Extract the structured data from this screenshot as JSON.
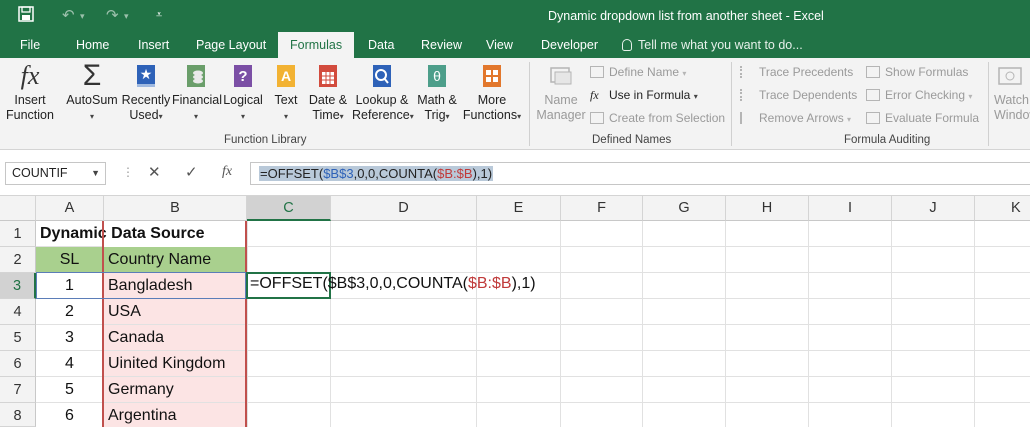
{
  "window": {
    "title": "Dynamic dropdown list from another sheet  -  Excel"
  },
  "tabs": [
    {
      "label": "File"
    },
    {
      "label": "Home"
    },
    {
      "label": "Insert"
    },
    {
      "label": "Page Layout"
    },
    {
      "label": "Formulas"
    },
    {
      "label": "Data"
    },
    {
      "label": "Review"
    },
    {
      "label": "View"
    },
    {
      "label": "Developer"
    }
  ],
  "tell_me": "Tell me what you want to do...",
  "ribbon": {
    "function_library": {
      "label": "Function Library",
      "insert_function": [
        "Insert",
        "Function"
      ],
      "autosum": "AutoSum",
      "recently_used": [
        "Recently",
        "Used"
      ],
      "financial": "Financial",
      "logical": "Logical",
      "text": "Text",
      "date_time": [
        "Date &",
        "Time"
      ],
      "lookup_reference": [
        "Lookup &",
        "Reference"
      ],
      "math_trig": [
        "Math &",
        "Trig"
      ],
      "more_functions": [
        "More",
        "Functions"
      ]
    },
    "defined_names": {
      "label": "Defined Names",
      "name_manager": [
        "Name",
        "Manager"
      ],
      "define_name": "Define Name",
      "use_in_formula": "Use in Formula",
      "create_from_selection": "Create from Selection"
    },
    "formula_auditing": {
      "label": "Formula Auditing",
      "trace_precedents": "Trace Precedents",
      "trace_dependents": "Trace Dependents",
      "remove_arrows": "Remove Arrows",
      "show_formulas": "Show Formulas",
      "error_checking": "Error Checking",
      "evaluate_formula": "Evaluate Formula",
      "watch_window": [
        "Watch",
        "Window"
      ]
    }
  },
  "formula_bar": {
    "name_box": "COUNTIF",
    "formula": {
      "p1": "=OFFSET(",
      "ref1": "$B$3",
      "p2": ",0,0,COUNTA(",
      "ref2": "$B:$B",
      "p3": "),1)"
    }
  },
  "columns": [
    "A",
    "B",
    "C",
    "D",
    "E",
    "F",
    "G",
    "H",
    "I",
    "J",
    "K"
  ],
  "rows": [
    "1",
    "2",
    "3",
    "4",
    "5",
    "6",
    "7",
    "8"
  ],
  "cells": {
    "a1": "Dynamic Data Source",
    "a2": "SL",
    "b2": "Country Name",
    "data": [
      {
        "sl": "1",
        "country": "Bangladesh"
      },
      {
        "sl": "2",
        "country": "USA"
      },
      {
        "sl": "3",
        "country": "Canada"
      },
      {
        "sl": "4",
        "country": "Uinited Kingdom"
      },
      {
        "sl": "5",
        "country": "Germany"
      },
      {
        "sl": "6",
        "country": "Argentina"
      }
    ],
    "c3_formula": {
      "p1": "=OFFSET(",
      "ref1": "$B$3",
      "p2": ",0,0,COUNTA(",
      "ref2": "$B:$B",
      "p3": "),1)"
    }
  },
  "colors": {
    "accent": "#217346",
    "header_fill": "#a9d08e",
    "range_fill": "#fce4e4",
    "range_border": "#c0504d",
    "ref_blue": "#2e62b8",
    "ref_red": "#c03a3a"
  }
}
